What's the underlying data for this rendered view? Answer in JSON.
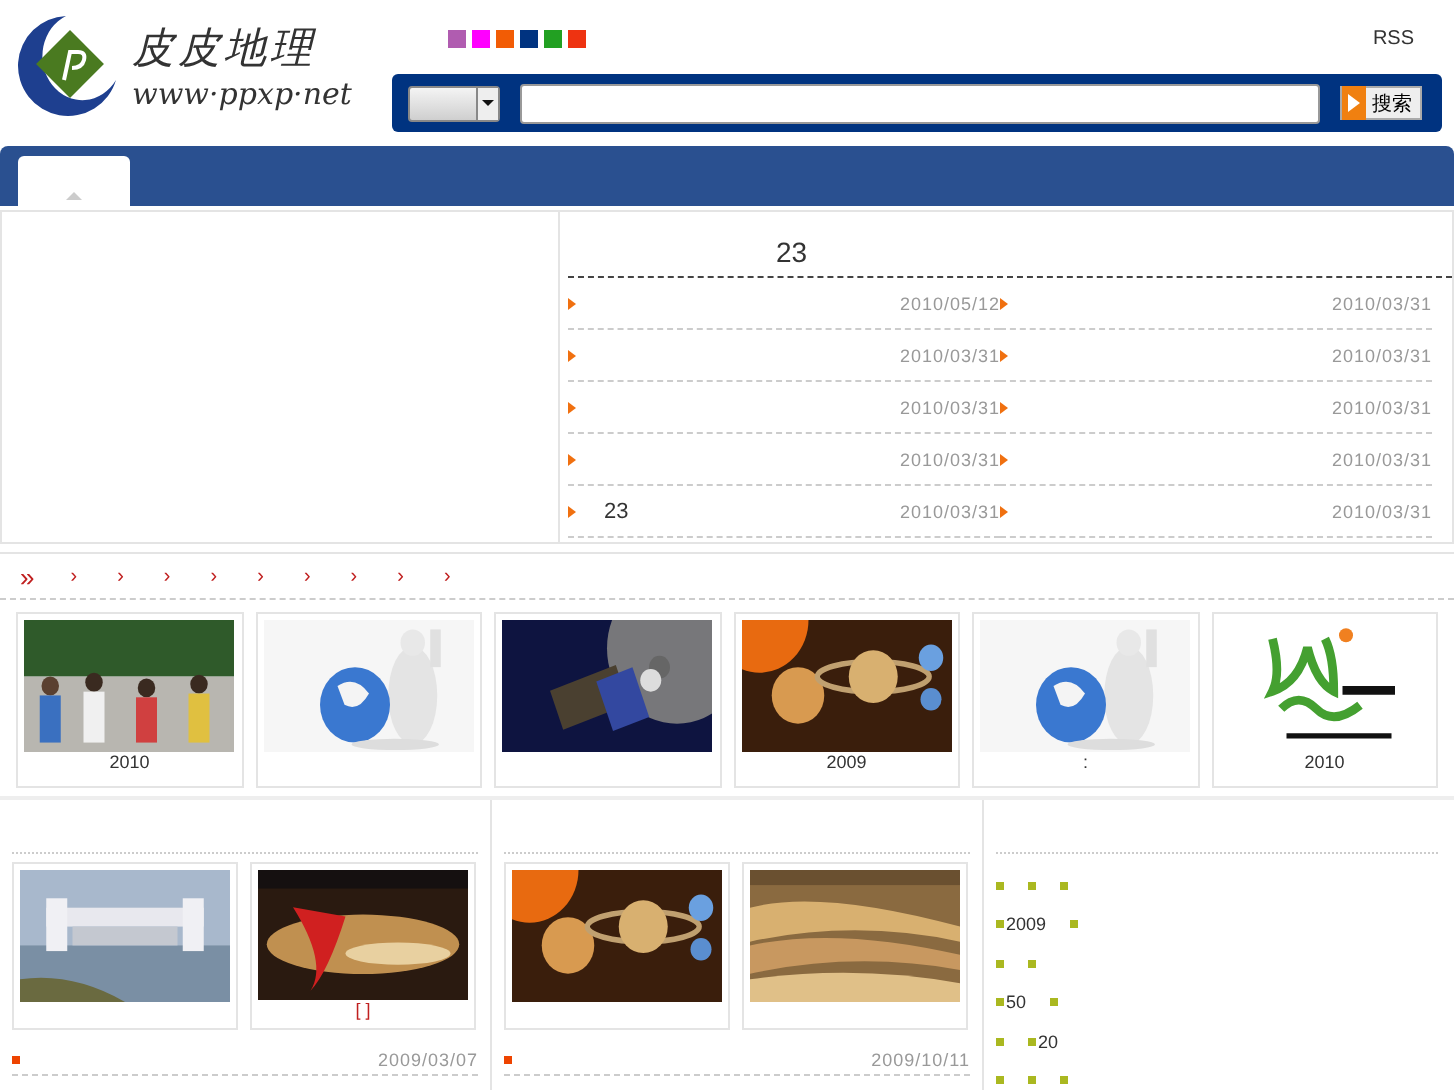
{
  "logo": {
    "name": "皮皮地理",
    "url": "www·ppxp·net"
  },
  "swatches": [
    {
      "color": "#b05cb0"
    },
    {
      "color": "#ff00ff"
    },
    {
      "color": "#f25c05"
    },
    {
      "color": "#003380"
    },
    {
      "color": "#22a022"
    },
    {
      "color": "#ee3311"
    }
  ],
  "rss": "RSS",
  "search": {
    "button": "搜索"
  },
  "tabs": [
    {
      "selected": true
    }
  ],
  "news": {
    "heading": "23",
    "columns": [
      [
        {
          "date": "2010/05/12"
        },
        {
          "date": "2010/03/31"
        },
        {
          "date": "2010/03/31"
        },
        {
          "date": "2010/03/31"
        },
        {
          "title": "23",
          "date": "2010/03/31"
        }
      ],
      [
        {
          "date": "2010/03/31"
        },
        {
          "date": "2010/03/31"
        },
        {
          "date": "2010/03/31"
        },
        {
          "date": "2010/03/31"
        },
        {
          "date": "2010/03/31"
        }
      ]
    ]
  },
  "category_bar": {
    "lead": "»",
    "markers": [
      "›",
      "›",
      "›",
      "›",
      "›",
      "›",
      "›",
      "›",
      "›"
    ]
  },
  "gallery": [
    {
      "kind": "picture",
      "caption": "2010"
    },
    {
      "kind": "picture"
    },
    {
      "kind": "picture"
    },
    {
      "kind": "picture",
      "caption": "2009"
    },
    {
      "kind": "picture",
      "caption": ":"
    },
    {
      "kind": "picture",
      "caption": "2010"
    }
  ],
  "panels": [
    {
      "items": [
        {
          "kind": "picture"
        },
        {
          "kind": "picture",
          "caption": "[ ]"
        }
      ],
      "date": "2009/03/07"
    },
    {
      "items": [
        {
          "kind": "picture"
        },
        {
          "kind": "picture"
        }
      ],
      "date": "2009/10/11"
    }
  ],
  "side_list": [
    {
      "items": [
        {
          "kind": "bullet"
        },
        {
          "kind": "bullet"
        },
        {
          "kind": "bullet"
        }
      ]
    },
    {
      "items": [
        {
          "kind": "bullet",
          "text": "2009"
        },
        {
          "kind": "bullet"
        }
      ]
    },
    {
      "items": [
        {
          "kind": "bullet"
        },
        {
          "kind": "bullet"
        }
      ]
    },
    {
      "items": [
        {
          "kind": "bullet",
          "text": "50"
        },
        {
          "kind": "bullet"
        }
      ]
    },
    {
      "items": [
        {
          "kind": "bullet"
        },
        {
          "kind": "bullet",
          "text": "20"
        }
      ]
    },
    {
      "items": [
        {
          "kind": "bullet"
        },
        {
          "kind": "bullet"
        },
        {
          "kind": "bullet"
        }
      ]
    }
  ]
}
